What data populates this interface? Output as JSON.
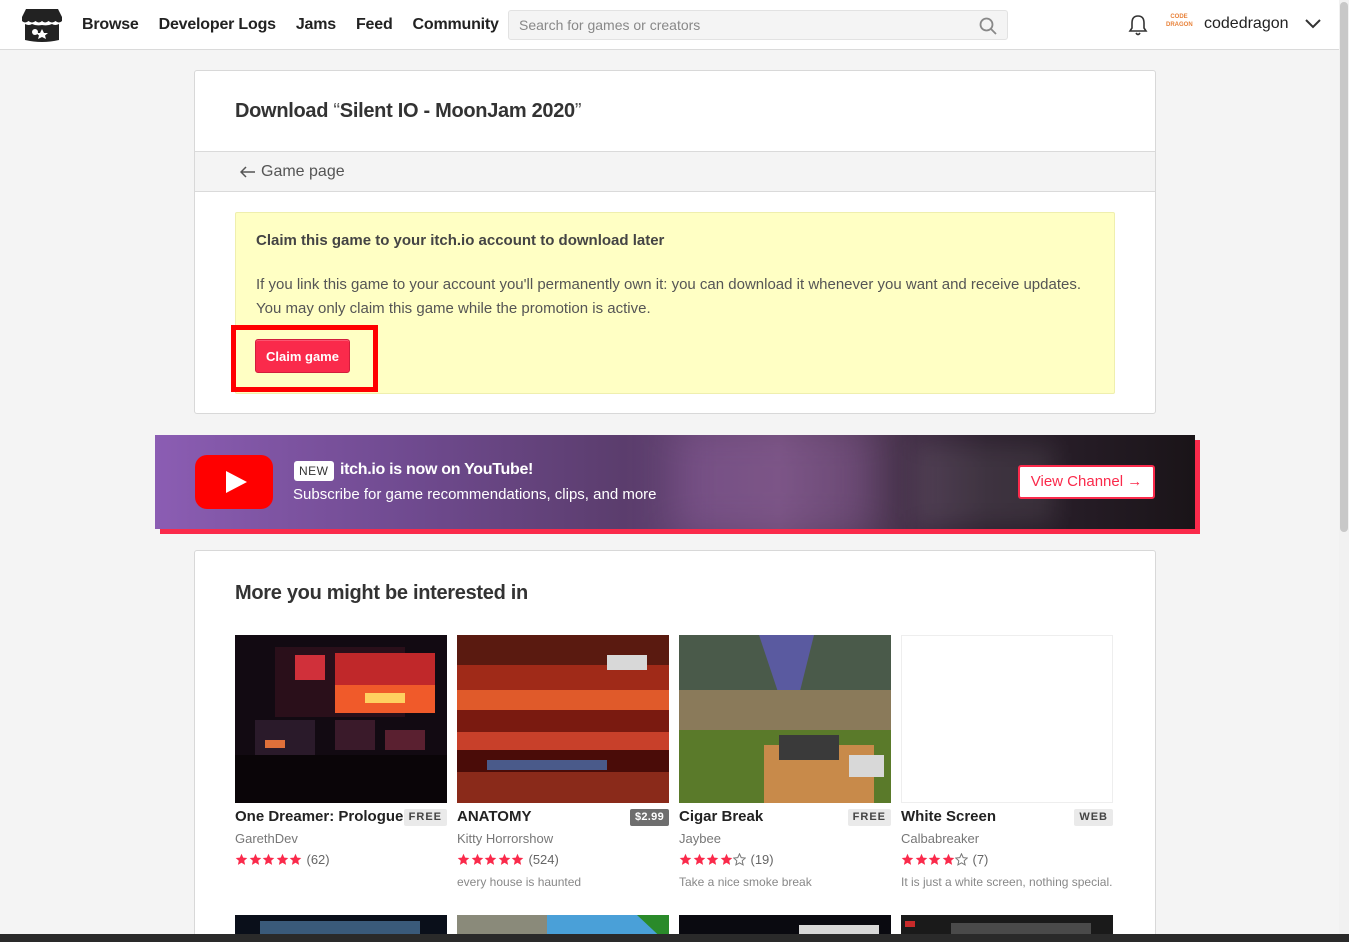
{
  "header": {
    "nav": [
      "Browse",
      "Developer Logs",
      "Jams",
      "Feed",
      "Community"
    ],
    "search_placeholder": "Search for games or creators",
    "username": "codedragon",
    "avatar_text": "CODE DRAGON"
  },
  "download": {
    "title_prefix": "Download ",
    "title_open_quote": "“",
    "title_game": "Silent IO - MoonJam 2020",
    "title_close_quote": "”",
    "back_link": "Game page",
    "claim_heading": "Claim this game to your itch.io account to download later",
    "claim_text": "If you link this game to your account you'll permanently own it: you can download it whenever you want and receive updates. You may only claim this game while the promotion is active.",
    "claim_button": "Claim game"
  },
  "banner": {
    "badge": "NEW",
    "title": "itch.io is now on YouTube!",
    "subtitle": "Subscribe for game recommendations, clips, and more",
    "button": "View Channel →"
  },
  "more": {
    "heading": "More you might be interested in",
    "games": [
      {
        "title": "One Dreamer: Prologue",
        "price": "FREE",
        "author": "GarethDev",
        "stars": 5,
        "count": "(62)",
        "desc": ""
      },
      {
        "title": "ANATOMY",
        "price": "$2.99",
        "author": "Kitty Horrorshow",
        "stars": 5,
        "count": "(524)",
        "desc": "every house is haunted"
      },
      {
        "title": "Cigar Break",
        "price": "FREE",
        "author": "Jaybee",
        "stars": 4,
        "count": "(19)",
        "desc": "Take a nice smoke break"
      },
      {
        "title": "White Screen",
        "price": "WEB",
        "author": "Calbabreaker",
        "stars": 4,
        "count": "(7)",
        "desc": "It is just a white screen, nothing special."
      }
    ]
  },
  "colors": {
    "accent": "#fa2a4b",
    "claim_bg": "#ffffc4",
    "highlight": "#ff0000"
  }
}
